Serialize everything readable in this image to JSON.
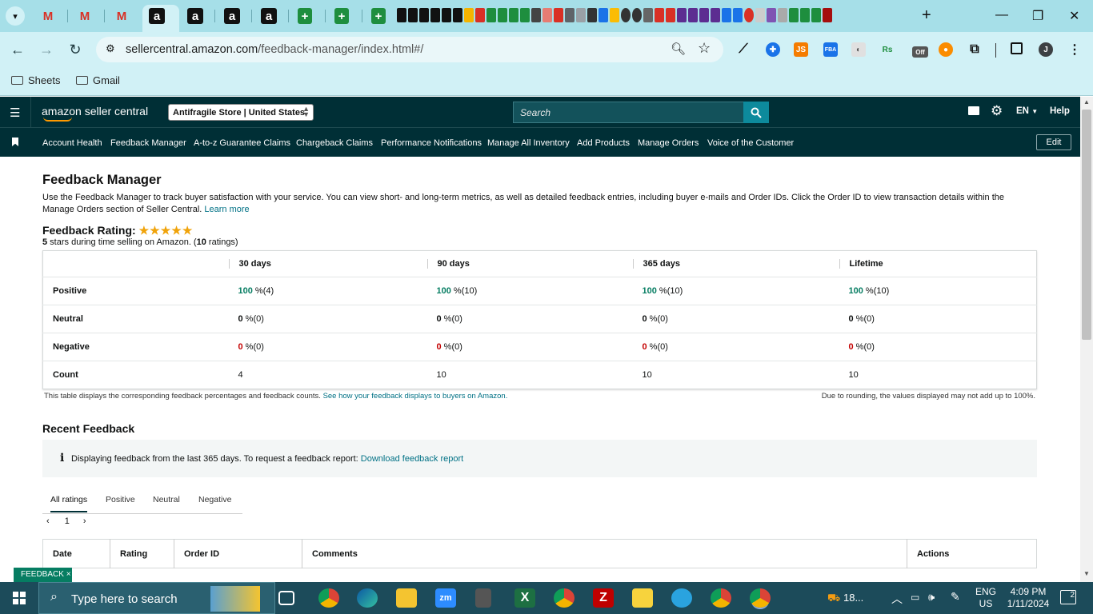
{
  "browser": {
    "url_domain": "sellercentral.amazon.com",
    "url_path": "/feedback-manager/index.html#/",
    "bookmarks": [
      "Sheets",
      "Gmail"
    ],
    "profile_initial": "J",
    "ext_off_label": "Off",
    "ext_js_label": "JS",
    "ext_rs_label": "Rs"
  },
  "header": {
    "logo_text": "amazon seller central",
    "store": "Antifragile Store | United States",
    "search_placeholder": "Search",
    "language": "EN",
    "help": "Help"
  },
  "subnav": {
    "items": [
      "Account Health",
      "Feedback Manager",
      "A-to-z Guarantee Claims",
      "Chargeback Claims",
      "Performance Notifications",
      "Manage All Inventory",
      "Add Products",
      "Manage Orders",
      "Voice of the Customer"
    ],
    "edit": "Edit"
  },
  "page": {
    "title": "Feedback Manager",
    "intro": "Use the Feedback Manager to track buyer satisfaction with your service. You can view short- and long-term metrics, as well as detailed feedback entries, including buyer e-mails and Order IDs. Click the Order ID to view transaction details within the Manage Orders section of Seller Central.",
    "learn_more": "Learn more",
    "rating_label": "Feedback Rating:",
    "stars": 5,
    "rating_sub_pre": "5",
    "rating_sub_mid": " stars during time selling on Amazon. (",
    "rating_sub_count": "10",
    "rating_sub_post": " ratings)"
  },
  "feedback_table": {
    "columns": [
      "30 days",
      "90 days",
      "365 days",
      "Lifetime"
    ],
    "rows": [
      {
        "label": "Positive",
        "cells": [
          [
            "100",
            " %(4)"
          ],
          [
            "100",
            " %(10)"
          ],
          [
            "100",
            " %(10)"
          ],
          [
            "100",
            " %(10)"
          ]
        ]
      },
      {
        "label": "Neutral",
        "cells": [
          [
            "0",
            " %(0)"
          ],
          [
            "0",
            " %(0)"
          ],
          [
            "0",
            " %(0)"
          ],
          [
            "0",
            " %(0)"
          ]
        ]
      },
      {
        "label": "Negative",
        "cells": [
          [
            "0",
            " %(0)"
          ],
          [
            "0",
            " %(0)"
          ],
          [
            "0",
            " %(0)"
          ],
          [
            "0",
            " %(0)"
          ]
        ]
      },
      {
        "label": "Count",
        "cells": [
          [
            "4",
            ""
          ],
          [
            "10",
            ""
          ],
          [
            "10",
            ""
          ],
          [
            "10",
            ""
          ]
        ]
      }
    ],
    "note_left": "This table displays the corresponding feedback percentages and feedback counts.",
    "note_link": "See how your feedback displays to buyers on Amazon.",
    "note_right": "Due to rounding, the values displayed may not add up to 100%."
  },
  "recent": {
    "title": "Recent Feedback",
    "info_text": "Displaying feedback from the last 365 days. To request a feedback report:",
    "info_link": "Download feedback report",
    "tabs": [
      "All ratings",
      "Positive",
      "Neutral",
      "Negative"
    ],
    "page": "1",
    "columns": [
      "Date",
      "Rating",
      "Order ID",
      "Comments",
      "Actions"
    ]
  },
  "feedback_tab": "FEEDBACK",
  "taskbar": {
    "search_placeholder": "Type here to search",
    "weather": "18...",
    "lang_top": "ENG",
    "lang_bottom": "US",
    "time": "4:09 PM",
    "date": "1/11/2024",
    "notif": "2",
    "zoom_label": "zm"
  },
  "colors": {
    "amazon_dark": "#002f36",
    "link": "#007185",
    "positive": "#067d62",
    "negative": "#c40000"
  }
}
